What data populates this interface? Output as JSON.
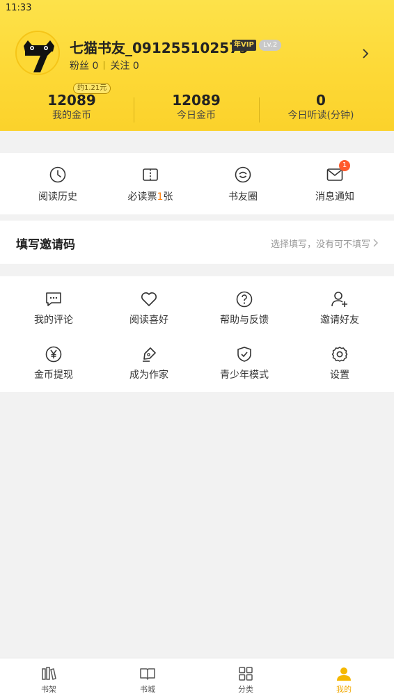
{
  "status_bar": {
    "time": "11:33"
  },
  "profile": {
    "username": "七猫书友_091255102579",
    "vip_badge": "年VIP",
    "level_badge": "Lv.2",
    "fans_label": "粉丝",
    "fans_count": "0",
    "follow_label": "关注",
    "follow_count": "0"
  },
  "stats": [
    {
      "value": "12089",
      "label": "我的金币",
      "tag": "约1.21元"
    },
    {
      "value": "12089",
      "label": "今日金币"
    },
    {
      "value": "0",
      "label": "今日听读(分钟)"
    }
  ],
  "quick_actions": [
    {
      "label": "阅读历史",
      "icon": "clock-icon"
    },
    {
      "label_pre": "必读票",
      "label_num": "1",
      "label_post": "张",
      "icon": "book-ticket-icon"
    },
    {
      "label": "书友圈",
      "icon": "smile-circle-icon"
    },
    {
      "label": "消息通知",
      "icon": "mail-icon",
      "badge": "1"
    }
  ],
  "invite": {
    "title": "填写邀请码",
    "hint": "选择填写，没有可不填写"
  },
  "menu": [
    {
      "label": "我的评论",
      "icon": "comment-icon"
    },
    {
      "label": "阅读喜好",
      "icon": "heart-icon"
    },
    {
      "label": "帮助与反馈",
      "icon": "help-icon"
    },
    {
      "label": "邀请好友",
      "icon": "add-user-icon"
    },
    {
      "label": "金币提现",
      "icon": "yen-icon"
    },
    {
      "label": "成为作家",
      "icon": "pen-icon"
    },
    {
      "label": "青少年模式",
      "icon": "shield-check-icon"
    },
    {
      "label": "设置",
      "icon": "gear-icon"
    }
  ],
  "tabs": [
    {
      "label": "书架",
      "icon": "bookshelf-icon"
    },
    {
      "label": "书城",
      "icon": "open-book-icon"
    },
    {
      "label": "分类",
      "icon": "grid-icon"
    },
    {
      "label": "我的",
      "icon": "person-icon",
      "active": true
    }
  ],
  "colors": {
    "header": "#fdd835",
    "accent": "#f0a800",
    "badge": "#ff5a2c"
  }
}
